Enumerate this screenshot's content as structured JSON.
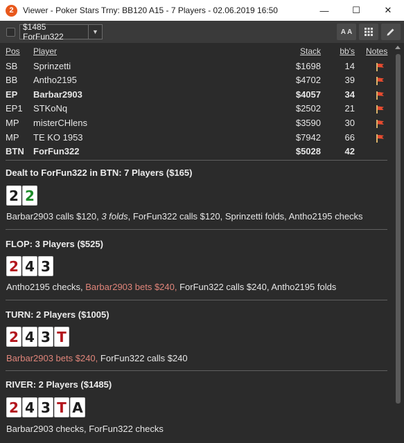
{
  "window": {
    "title": "Viewer - Poker Stars Trny: BB120 A15 - 7 Players - 02.06.2019 16:50",
    "app_icon_letter": "2",
    "minimize": "—",
    "maximize": "☐",
    "close": "✕"
  },
  "toolbar": {
    "hand_select_value": "$1485 ForFun322",
    "font_button_label": "A A",
    "grid_icon": "grid-icon",
    "edit_icon": "pencil-icon"
  },
  "table": {
    "headers": {
      "pos": "Pos",
      "player": "Player",
      "stack": "Stack",
      "bbs": "bb's",
      "notes": "Notes"
    },
    "rows": [
      {
        "pos": "SB",
        "player": "Sprinzetti",
        "stack": "$1698",
        "bbs": "14",
        "bold": false
      },
      {
        "pos": "BB",
        "player": "Antho2195",
        "stack": "$4702",
        "bbs": "39",
        "bold": false
      },
      {
        "pos": "EP",
        "player": "Barbar2903",
        "stack": "$4057",
        "bbs": "34",
        "bold": true
      },
      {
        "pos": "EP1",
        "player": "STKoNq",
        "stack": "$2502",
        "bbs": "21",
        "bold": false
      },
      {
        "pos": "MP",
        "player": "misterCHlens",
        "stack": "$3590",
        "bbs": "30",
        "bold": false
      },
      {
        "pos": "MP",
        "player": "TE KO 1953",
        "stack": "$7942",
        "bbs": "66",
        "bold": false
      },
      {
        "pos": "BTN",
        "player": "ForFun322",
        "stack": "$5028",
        "bbs": "42",
        "bold": true
      }
    ]
  },
  "streets": {
    "preflop": {
      "title": "Dealt to ForFun322 in BTN: 7 Players ($165)",
      "cards": [
        {
          "rank": "2",
          "color": "black"
        },
        {
          "rank": "2",
          "color": "green"
        }
      ],
      "actions": {
        "a1": "Barbar2903 calls $120, ",
        "a2": "3 folds",
        "a3": ", ForFun322 calls $120, Sprinzetti folds, Antho2195 checks"
      }
    },
    "flop": {
      "title": "FLOP: 3 Players ($525)",
      "cards": [
        {
          "rank": "2",
          "color": "red"
        },
        {
          "rank": "4",
          "color": "black"
        },
        {
          "rank": "3",
          "color": "black"
        }
      ],
      "actions": {
        "a1": "Antho2195 checks, ",
        "a2": "Barbar2903 bets $240,",
        "a3": " ForFun322 calls $240, Antho2195 folds"
      }
    },
    "turn": {
      "title": "TURN: 2 Players ($1005)",
      "cards": [
        {
          "rank": "2",
          "color": "red"
        },
        {
          "rank": "4",
          "color": "black"
        },
        {
          "rank": "3",
          "color": "black"
        },
        {
          "rank": "T",
          "color": "red"
        }
      ],
      "actions": {
        "a1": "Barbar2903 bets $240,",
        "a2": " ForFun322 calls $240"
      }
    },
    "river": {
      "title": "RIVER: 2 Players ($1485)",
      "cards": [
        {
          "rank": "2",
          "color": "red"
        },
        {
          "rank": "4",
          "color": "black"
        },
        {
          "rank": "3",
          "color": "black"
        },
        {
          "rank": "T",
          "color": "red"
        },
        {
          "rank": "A",
          "color": "black"
        }
      ],
      "actions": {
        "a1": "Barbar2903 checks, ForFun322 checks"
      }
    }
  },
  "colors": {
    "background": "#2b2b2b",
    "highlight_action": "#e0857a",
    "card_red": "#b3161d",
    "card_green": "#1e8c2a",
    "flag": "#e84b2f"
  }
}
